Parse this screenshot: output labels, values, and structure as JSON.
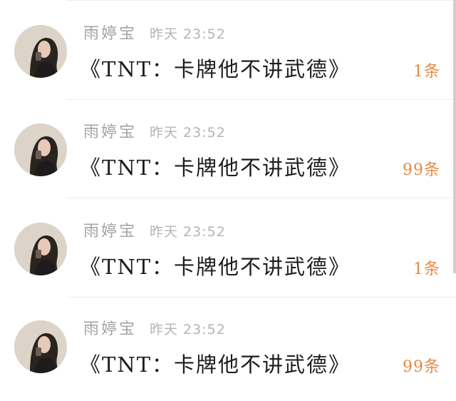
{
  "messages": [
    {
      "sender": "雨婷宝",
      "time": "昨天 23:52",
      "text": "《TNT：卡牌他不讲武德》",
      "count": "1条"
    },
    {
      "sender": "雨婷宝",
      "time": "昨天 23:52",
      "text": "《TNT：卡牌他不讲武德》",
      "count": "99条"
    },
    {
      "sender": "雨婷宝",
      "time": "昨天 23:52",
      "text": "《TNT：卡牌他不讲武德》",
      "count": "1条"
    },
    {
      "sender": "雨婷宝",
      "time": "昨天 23:52",
      "text": "《TNT：卡牌他不讲武德》",
      "count": "99条"
    }
  ],
  "colors": {
    "sender": "#a4a4a4",
    "time": "#b4b4b4",
    "message": "#1c1c1c",
    "count": "#e68a43",
    "divider": "#eeeeee"
  },
  "icons": {
    "avatar": "user-avatar-photo"
  }
}
